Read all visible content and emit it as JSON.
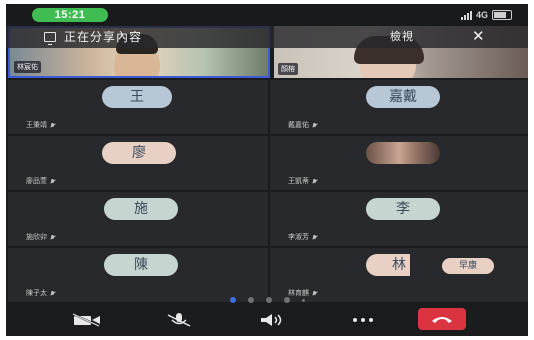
{
  "status_bar": {
    "time": "15:21",
    "network": "4G"
  },
  "share_banner": {
    "text": "正在分享內容",
    "view_label": "檢視",
    "close_label": "✕"
  },
  "videos": [
    {
      "name": "林宸佑"
    },
    {
      "name": "顏榕"
    }
  ],
  "participants": [
    {
      "avatar": "王",
      "name": "王秉靖",
      "avatar_color": "#b8c7d6"
    },
    {
      "avatar": "嘉戴",
      "name": "戴嘉佑",
      "avatar_color": "#b8c7d6"
    },
    {
      "avatar": "廖",
      "name": "廖品萱",
      "avatar_color": "#e9d0c4"
    },
    {
      "avatar": "",
      "name": "王凱蒂",
      "avatar_color": "#8b6f60",
      "photo": true
    },
    {
      "avatar": "施",
      "name": "施欣卯",
      "avatar_color": "#c6d5cf"
    },
    {
      "avatar": "李",
      "name": "李淑芳",
      "avatar_color": "#c6d5cf"
    },
    {
      "avatar": "陳",
      "name": "陳子太",
      "avatar_color": "#c6d5cf"
    },
    {
      "avatar": "林",
      "name": "林育麒",
      "avatar_color": "#e9d0c4",
      "extra": "早康"
    }
  ],
  "pagination": {
    "pages": 5,
    "current": 1
  },
  "toolbar": [
    "camera-off",
    "mic-off",
    "speaker",
    "more",
    "end-call"
  ],
  "colors": {
    "accent": "#3d6fe0",
    "end_call": "#d9343f",
    "time_pill": "#3fbd52"
  }
}
